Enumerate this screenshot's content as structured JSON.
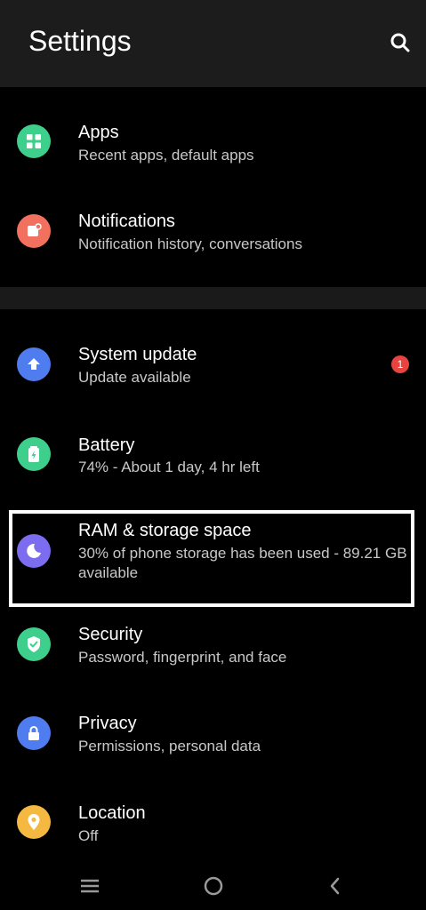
{
  "header": {
    "title": "Settings",
    "search_icon": "search-icon"
  },
  "items": [
    {
      "title": "Apps",
      "subtitle": "Recent apps, default apps",
      "icon": "apps-icon",
      "color": "#3fcf8c"
    },
    {
      "title": "Notifications",
      "subtitle": "Notification history, conversations",
      "icon": "notification-icon",
      "color": "#f2705e"
    },
    {
      "title": "System update",
      "subtitle": "Update available",
      "icon": "system-update-icon",
      "color": "#4f7df0",
      "badge": "1"
    },
    {
      "title": "Battery",
      "subtitle": "74% - About 1 day, 4 hr left",
      "icon": "battery-icon",
      "color": "#3fcf8c"
    },
    {
      "title": "RAM & storage space",
      "subtitle": "30% of phone storage has been used - 89.21 GB available",
      "icon": "storage-icon",
      "color": "#7c6cf0"
    },
    {
      "title": "Security",
      "subtitle": "Password, fingerprint, and face",
      "icon": "shield-icon",
      "color": "#3fcf8c"
    },
    {
      "title": "Privacy",
      "subtitle": "Permissions, personal data",
      "icon": "lock-icon",
      "color": "#4f7df0"
    },
    {
      "title": "Location",
      "subtitle": "Off",
      "icon": "location-icon",
      "color": "#f5b840"
    }
  ],
  "navbar": {
    "menu_icon": "menu-icon",
    "home_icon": "home-icon",
    "back_icon": "back-icon"
  },
  "colors": {
    "background": "#000000",
    "header": "#1c1c1c",
    "badge": "#e8433f"
  }
}
